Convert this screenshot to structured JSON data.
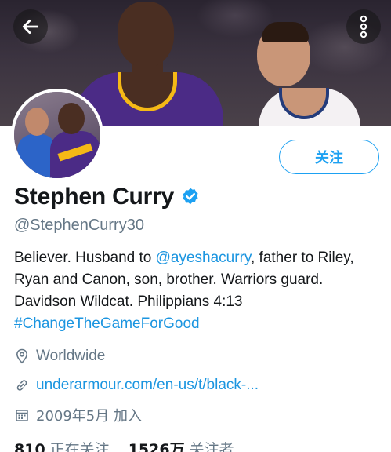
{
  "profile": {
    "display_name": "Stephen Curry",
    "handle": "@StephenCurry30",
    "verified": true,
    "bio": {
      "part1": "Believer. Husband to ",
      "mention": "@ayeshacurry",
      "part2": ", father to Riley, Ryan and Canon, son, brother. Warriors guard. Davidson Wildcat. Philippians 4:13",
      "hashtag": "#ChangeTheGameForGood"
    },
    "location": "Worldwide",
    "website": "underarmour.com/en-us/t/black-...",
    "joined": "2009年5月 加入"
  },
  "actions": {
    "follow_label": "关注"
  },
  "stats": {
    "following_count": "810",
    "following_label": "正在关注",
    "followers_count": "1526万",
    "followers_label": "关注者"
  },
  "colors": {
    "accent": "#1da1f2",
    "link": "#1b95e0",
    "secondary_text": "#657786",
    "primary_text": "#14171a"
  },
  "icons": {
    "back": "back-arrow-icon",
    "more": "more-vertical-icon",
    "verified": "verified-badge-icon",
    "location": "location-pin-icon",
    "link": "link-icon",
    "calendar": "calendar-icon"
  }
}
